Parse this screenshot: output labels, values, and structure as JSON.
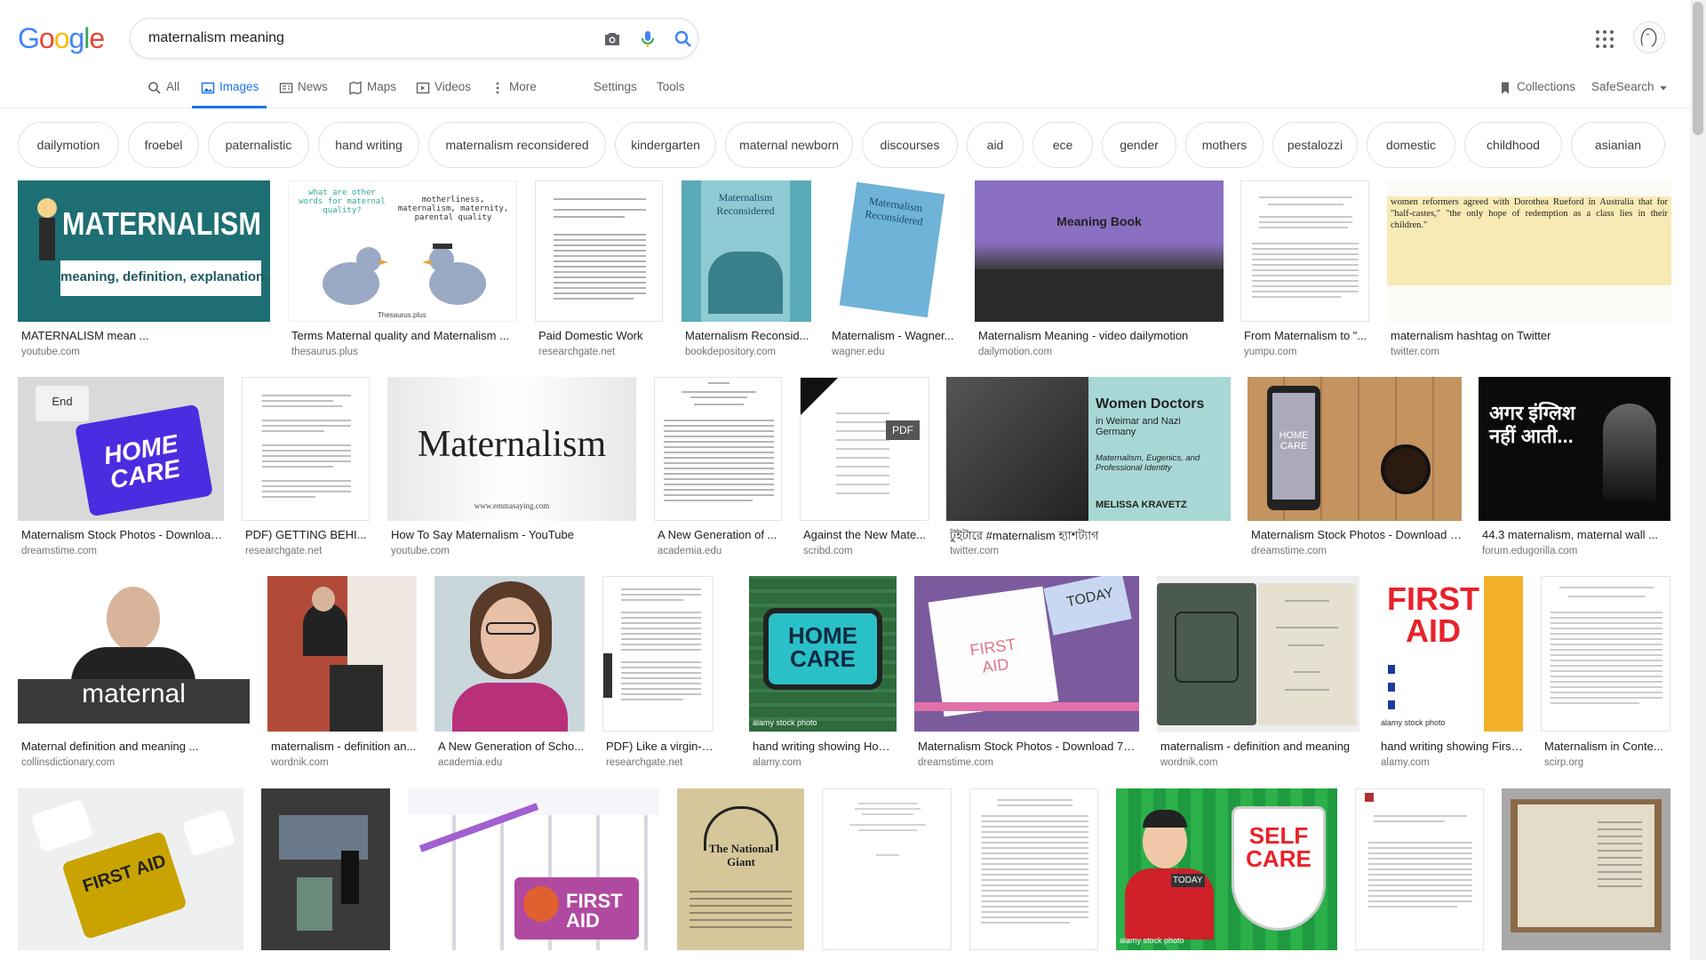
{
  "search": {
    "query": "maternalism meaning"
  },
  "logo": {
    "letters": [
      "G",
      "o",
      "o",
      "g",
      "l",
      "e"
    ],
    "colors": [
      "#4285f4",
      "#ea4335",
      "#fbbc05",
      "#4285f4",
      "#34a853",
      "#ea4335"
    ]
  },
  "icons": {
    "camera": "camera-icon",
    "mic": "microphone-icon",
    "search": "search-icon",
    "apps": "apps-grid-icon"
  },
  "colors": {
    "accent": "#1a73e8"
  },
  "tabs": {
    "all": "All",
    "images": "Images",
    "news": "News",
    "maps": "Maps",
    "videos": "Videos",
    "more": "More",
    "settings": "Settings",
    "tools": "Tools",
    "collections": "Collections",
    "safesearch": "SafeSearch"
  },
  "chips": [
    "dailymotion",
    "froebel",
    "paternalistic",
    "hand writing",
    "maternalism reconsidered",
    "kindergarten",
    "maternal newborn",
    "discourses",
    "aid",
    "ece",
    "gender",
    "mothers",
    "pestalozzi",
    "domestic",
    "childhood",
    "asianian"
  ],
  "results": {
    "r1": [
      {
        "title": "MATERNALISM mean ...",
        "domain": "youtube.com"
      },
      {
        "title": "Terms Maternal quality and Maternalism ...",
        "domain": "thesaurus.plus"
      },
      {
        "title": "Paid Domestic Work",
        "domain": "researchgate.net"
      },
      {
        "title": "Maternalism Reconsid...",
        "domain": "bookdepository.com"
      },
      {
        "title": "Maternalism - Wagner...",
        "domain": "wagner.edu"
      },
      {
        "title": "Maternalism Meaning - video dailymotion",
        "domain": "dailymotion.com"
      },
      {
        "title": "From Maternalism to \"...",
        "domain": "yumpu.com"
      },
      {
        "title": "maternalism hashtag on Twitter",
        "domain": "twitter.com"
      }
    ],
    "r2": [
      {
        "title": "Maternalism Stock Photos - Download...",
        "domain": "dreamstime.com"
      },
      {
        "title": "PDF) GETTING BEHI...",
        "domain": "researchgate.net"
      },
      {
        "title": "How To Say Maternalism - YouTube",
        "domain": "youtube.com"
      },
      {
        "title": "A New Generation of ...",
        "domain": "academia.edu"
      },
      {
        "title": "Against the New Mate...",
        "domain": "scribd.com"
      },
      {
        "title": "টুইটারে #maternalism হ্যাশট্যাগ",
        "domain": "twitter.com"
      },
      {
        "title": "Maternalism Stock Photos - Download 7...",
        "domain": "dreamstime.com"
      },
      {
        "title": "44.3 maternalism, maternal wall ...",
        "domain": "forum.edugorilla.com"
      }
    ],
    "r3": [
      {
        "title": "Maternal definition and meaning ...",
        "domain": "collinsdictionary.com"
      },
      {
        "title": "maternalism - definition an...",
        "domain": "wordnik.com"
      },
      {
        "title": "A New Generation of Scho...",
        "domain": "academia.edu"
      },
      {
        "title": "PDF) Like a virgin-mot...",
        "domain": "researchgate.net"
      },
      {
        "title": "hand writing showing Hom...",
        "domain": "alamy.com"
      },
      {
        "title": "Maternalism Stock Photos - Download 78 ...",
        "domain": "dreamstime.com"
      },
      {
        "title": "maternalism - definition and meaning",
        "domain": "wordnik.com"
      },
      {
        "title": "hand writing showing First...",
        "domain": "alamy.com"
      },
      {
        "title": "Maternalism in Conte...",
        "domain": "scirp.org"
      }
    ]
  },
  "thumbtext": {
    "maternalism": "MATERNALISM",
    "meaning_def": "meaning, definition, explanation...",
    "what_other": "what are other words for maternal quality?",
    "motherliness": "motherliness, maternalism, maternity, parental quality",
    "thesaurus": "Thesaurus.plus",
    "reconsidered": "Maternalism Reconsidered",
    "meaning_book": "Meaning Book",
    "home_care": "HOME CARE",
    "end_key": "End",
    "maternalism_serif": "Maternalism",
    "emmasaying": "www.emmasaying.com",
    "pdf": "PDF",
    "women_doctors": "Women Doctors",
    "weimar": "in Weimar and Nazi Germany",
    "eugenics": "Maternalism, Eugenics, and Professional Identity",
    "kravetz": "MELISSA KRAVETZ",
    "hindi": "अगर इंग्लिश नहीं आती...",
    "maternal": "maternal",
    "alamy": "alamy stock photo",
    "first_aid": "FIRST AID",
    "today": "TODAY",
    "self_care": "SELF CARE",
    "national_giant": "The National Giant",
    "quote": "women reformers agreed with Dorothea Rueford in Australia that for \"half-castes,\" \"the only hope of redemption as a class lies in their children.\""
  }
}
